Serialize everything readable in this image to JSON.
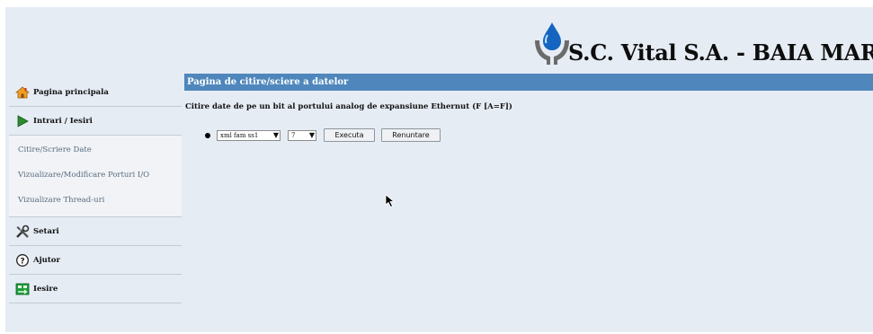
{
  "header": {
    "company_name": "S.C. Vital S.A. - BAIA MARE",
    "logo_icon": "water-drop-hands-logo"
  },
  "sidebar": {
    "items": [
      {
        "label": "Pagina principala",
        "icon": "home-icon"
      },
      {
        "label": "Intrari / Iesiri",
        "icon": "play-arrow-icon"
      },
      {
        "label": "Setari",
        "icon": "tools-icon"
      },
      {
        "label": "Ajutor",
        "icon": "help-icon"
      },
      {
        "label": "Iesire",
        "icon": "exit-icon"
      }
    ],
    "submenu": [
      {
        "label": "Citire/Scriere Date"
      },
      {
        "label": "Vizualizare/Modificare Porturi I/O"
      },
      {
        "label": "Vizualizare Thread-uri"
      }
    ]
  },
  "content": {
    "title": "Pagina de citire/sciere a datelor",
    "heading": "Citire date de pe un bit al portului analog de expansiune Ethernut (F [A=F])",
    "form": {
      "select_1_value": "xml fam ss1",
      "select_2_value": "7",
      "execute_label": "Executa",
      "cancel_label": "Renuntare"
    }
  },
  "colors": {
    "page_background": "#e5ecf4",
    "title_bar": "#4f87bc",
    "submenu_text": "#5a6c80"
  }
}
